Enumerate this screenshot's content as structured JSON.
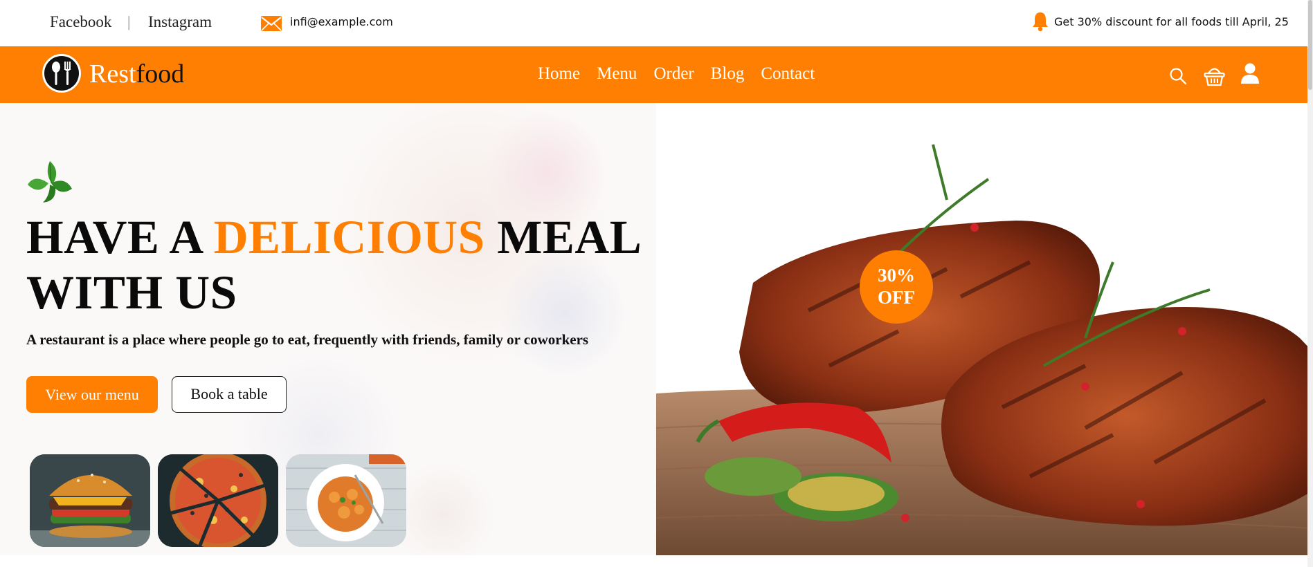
{
  "topbar": {
    "social_links": [
      {
        "label": "Facebook"
      },
      {
        "label": "Instagram"
      }
    ],
    "separator": "|",
    "email": "infi@example.com",
    "promo": "Get 30% discount for all foods till April, 25",
    "icons": {
      "email": "mail-icon",
      "promo": "bell-icon"
    }
  },
  "brand": {
    "name_part1": "Rest",
    "name_part2": "food",
    "accent_color": "#fe7f01"
  },
  "nav": {
    "links": [
      {
        "label": "Home"
      },
      {
        "label": "Menu"
      },
      {
        "label": "Order"
      },
      {
        "label": "Blog"
      },
      {
        "label": "Contact"
      }
    ],
    "icons": [
      "search-icon",
      "basket-icon",
      "user-icon"
    ]
  },
  "hero": {
    "headline_part1": "HAVE A ",
    "headline_highlight": "DELICIOUS",
    "headline_part2": " MEAL",
    "headline_line2": "WITH US",
    "subtitle": "A restaurant is a place where people go to eat, frequently with friends, family or coworkers",
    "primary_button": "View our menu",
    "secondary_button": "Book a table",
    "thumbnails": [
      "burger",
      "pizza",
      "pasta"
    ],
    "badge_line1": "30%",
    "badge_line2": "OFF"
  }
}
